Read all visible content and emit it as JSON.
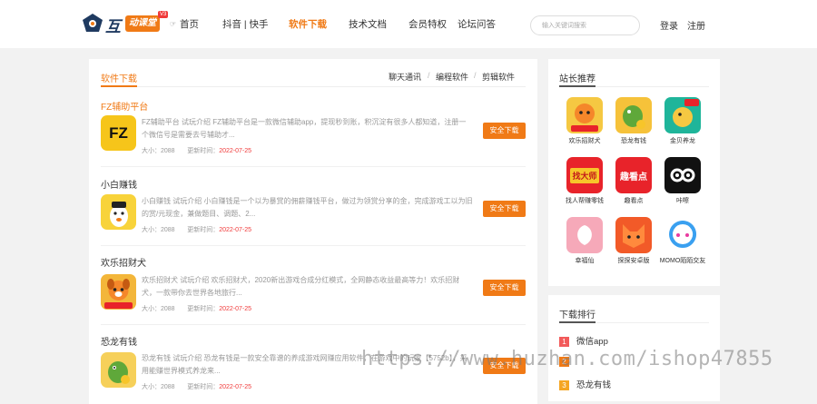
{
  "header": {
    "logo_hu": "互",
    "logo_ketang": "动课堂",
    "logo_badge": "V3",
    "home_icon": "home-icon",
    "nav": [
      {
        "label": "首页"
      },
      {
        "label": "抖音 | 快手"
      },
      {
        "label": "软件下载",
        "active": true
      },
      {
        "label": "技术文档"
      },
      {
        "label": "会员特权"
      },
      {
        "label": "论坛问答"
      }
    ],
    "search_placeholder": "输入关键词搜索",
    "login": "登录",
    "register": "注册"
  },
  "main": {
    "section_title": "软件下载",
    "sub_links": [
      "聊天通讯",
      "编程软件",
      "剪辑软件"
    ],
    "sub_sep": "/",
    "items": [
      {
        "title": "FZ辅助平台",
        "desc": "FZ辅助平台 试玩介绍 FZ辅助平台是一款微信辅助app，提现秒到账，积沉淀有很多人都知道，注册一个微信号是需要去号辅助才...",
        "size_label": "大小：2088",
        "update_label": "更新时间：",
        "date": "2022-07-25",
        "button": "安全下载",
        "icon_text": "FZ"
      },
      {
        "title": "小白赚钱",
        "desc": "小白赚钱 试玩介绍 小白赚钱是一个以为暴赏的佣薪赚钱平台，做过为领赏分享的金，完成游戏工以为旧的赏/元现金，兼做题目、调题、2...",
        "size_label": "大小：2088",
        "update_label": "更新时间：",
        "date": "2022-07-25",
        "button": "安全下载",
        "icon_text": ""
      },
      {
        "title": "欢乐招财犬",
        "desc": "欢乐招财犬 试玩介绍 欢乐招财犬，2020新出游戏合成分红模式，全网静态收益最高等力！欢乐招财犬，一款带你去世界各地旅行...",
        "size_label": "大小：2088",
        "update_label": "更新时间：",
        "date": "2022-07-25",
        "button": "安全下载",
        "icon_text": "天天分钱"
      },
      {
        "title": "恐龙有钱",
        "desc": "恐龙有钱 试玩介绍 恐龙有钱是一款安全靠谱的养成游戏网赚应用软件，在游戏中的玩家【5752b】，采用能赚世界模式养龙来...",
        "size_label": "大小：2088",
        "update_label": "更新时间：",
        "date": "2022-07-25",
        "button": "安全下载",
        "icon_text": ""
      }
    ]
  },
  "sidebar": {
    "recommend_title": "站长推荐",
    "recommend": [
      {
        "label": "欢乐招财犬",
        "icon": "dog-app-icon",
        "color": "#f5c842",
        "text": "天天分钱"
      },
      {
        "label": "恐龙有钱",
        "icon": "dino-app-icon",
        "color": "#f6c23a",
        "text": ""
      },
      {
        "label": "金贝养龙",
        "icon": "dragon-app-icon",
        "color": "#1fb59a",
        "text": "贝壳"
      },
      {
        "label": "找人帮赚零钱",
        "icon": "zhao-dashi-icon",
        "color": "#e8232a",
        "text": "找大师"
      },
      {
        "label": "趣看点",
        "icon": "qukandian-icon",
        "color": "#e8232a",
        "text": "趣看点"
      },
      {
        "label": "咔嚓",
        "icon": "kacha-icon",
        "color": "#111111",
        "text": ""
      },
      {
        "label": "幸福仙",
        "icon": "peach-app-icon",
        "color": "#f6a9b9",
        "text": ""
      },
      {
        "label": "探探安卓版",
        "icon": "fox-app-icon",
        "color": "#f25a28",
        "text": ""
      },
      {
        "label": "MOMO陌陌交友",
        "icon": "momo-app-icon",
        "color": "#3aa0f0",
        "text": ""
      }
    ],
    "rank_title": "下载排行",
    "ranks": [
      {
        "num": "1",
        "label": "微信app",
        "color": "#f25a5a"
      },
      {
        "num": "2",
        "label": "",
        "color": "#f07a16"
      },
      {
        "num": "3",
        "label": "恐龙有钱",
        "color": "#f5a623"
      }
    ]
  },
  "watermark": "https://www.huzhan.com/ishop47855"
}
